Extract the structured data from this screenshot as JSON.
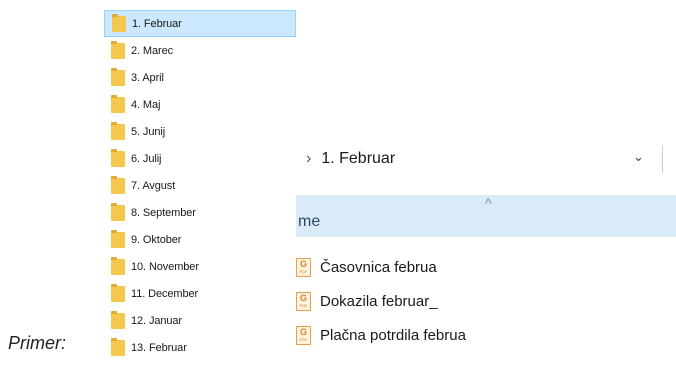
{
  "caption": "Primer:",
  "folders": [
    {
      "label": "1. Februar",
      "selected": true
    },
    {
      "label": "2. Marec"
    },
    {
      "label": "3. April"
    },
    {
      "label": "4. Maj"
    },
    {
      "label": "5. Junij"
    },
    {
      "label": "6. Julij"
    },
    {
      "label": "7. Avgust"
    },
    {
      "label": "8. September"
    },
    {
      "label": "9. Oktober"
    },
    {
      "label": "10. November"
    },
    {
      "label": "11. December"
    },
    {
      "label": "12. Januar"
    },
    {
      "label": "13. Februar"
    }
  ],
  "explorer": {
    "breadcrumb_separator": "›",
    "address": "1. Februar",
    "dropdown_glyph": "⌄",
    "sort_glyph": "^",
    "column_name": "me",
    "files": [
      {
        "label": "Časovnica februa",
        "icon": "gpdf-file-icon"
      },
      {
        "label": "Dokazila februar_",
        "icon": "gpdf-file-icon"
      },
      {
        "label": "Plačna potrdila februa",
        "icon": "gpdf-file-icon"
      }
    ]
  },
  "colors": {
    "selection": "#cce8ff",
    "folder": "#f5c74c",
    "header": "#dbeaf7",
    "file_icon_accent": "#e4a24a"
  }
}
